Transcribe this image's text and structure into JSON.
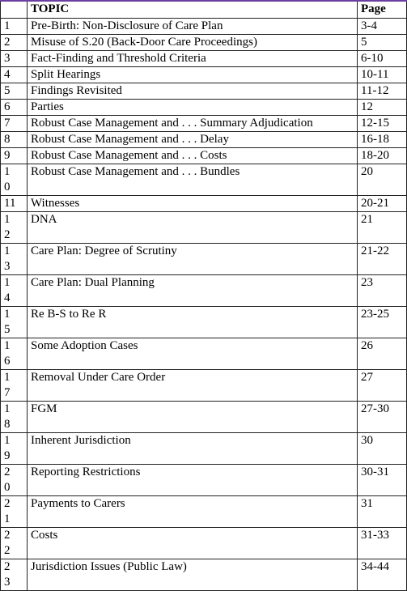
{
  "header": {
    "num": "",
    "topic": "TOPIC",
    "page": "Page"
  },
  "rows": [
    {
      "num": "1",
      "topic": "Pre-Birth: Non-Disclosure of Care Plan",
      "page": "3-4"
    },
    {
      "num": "2",
      "topic": "Misuse of S.20 (Back-Door Care Proceedings)",
      "page": "5"
    },
    {
      "num": "3",
      "topic": "Fact-Finding and Threshold Criteria",
      "page": "6-10"
    },
    {
      "num": "4",
      "topic": "Split Hearings",
      "page": "10-11"
    },
    {
      "num": "5",
      "topic": "Findings Revisited",
      "page": "11-12"
    },
    {
      "num": "6",
      "topic": "Parties",
      "page": "12"
    },
    {
      "num": "7",
      "topic": "Robust Case Management and . . . Summary Adjudication",
      "page": "12-15"
    },
    {
      "num": "8",
      "topic": "Robust Case Management and . . . Delay",
      "page": "16-18"
    },
    {
      "num": "9",
      "topic": "Robust Case Management and . . . Costs",
      "page": "18-20"
    },
    {
      "num": "10",
      "topic": "Robust Case Management and . . . Bundles",
      "page": "20"
    },
    {
      "num": "11",
      "topic": "Witnesses",
      "page": "20-21"
    },
    {
      "num": "12",
      "topic": "DNA",
      "page": "21"
    },
    {
      "num": "13",
      "topic": "Care Plan: Degree of Scrutiny",
      "page": "21-22"
    },
    {
      "num": "14",
      "topic": "Care Plan: Dual Planning",
      "page": "23"
    },
    {
      "num": "15",
      "topic": "Re B-S to Re R",
      "page": "23-25"
    },
    {
      "num": "16",
      "topic": "Some Adoption Cases",
      "page": "26"
    },
    {
      "num": "17",
      "topic": "Removal Under Care Order",
      "page": "27"
    },
    {
      "num": "18",
      "topic": "FGM",
      "page": "27-30"
    },
    {
      "num": "19",
      "topic": "Inherent Jurisdiction",
      "page": "30"
    },
    {
      "num": "20",
      "topic": "Reporting Restrictions",
      "page": "30-31"
    },
    {
      "num": "21",
      "topic": "Payments to Carers",
      "page": "31"
    },
    {
      "num": "22",
      "topic": "Costs",
      "page": "31-33"
    },
    {
      "num": "23",
      "topic": "Jurisdiction Issues (Public Law)",
      "page": "34-44"
    }
  ]
}
